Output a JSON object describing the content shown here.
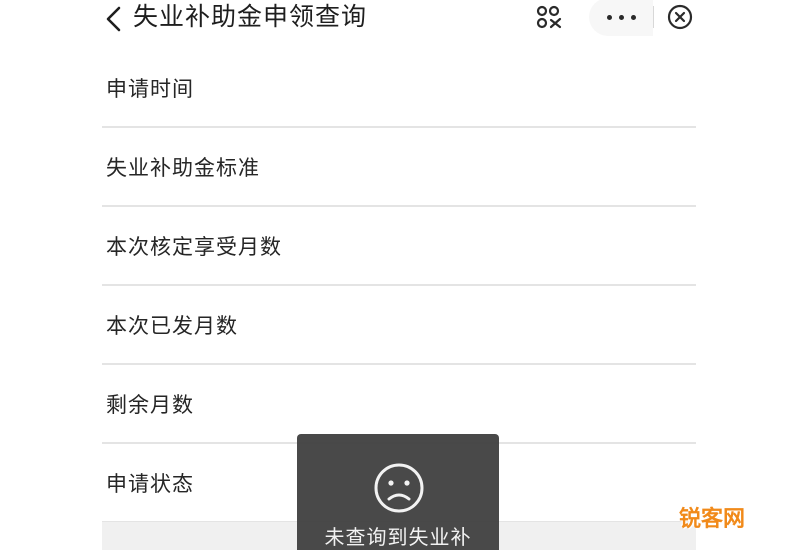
{
  "header": {
    "title": "失业补助金申领查询",
    "back_icon": "chevron-left-icon",
    "scan_icon": "scan-icon",
    "more_icon": "more-icon",
    "close_icon": "close-circle-icon"
  },
  "rows": [
    {
      "label": "申请时间"
    },
    {
      "label": "失业补助金标准"
    },
    {
      "label": "本次核定享受月数"
    },
    {
      "label": "本次已发月数"
    },
    {
      "label": "剩余月数"
    },
    {
      "label": "申请状态"
    }
  ],
  "toast": {
    "icon": "sad-face-icon",
    "message": "未查询到失业补"
  },
  "watermark": {
    "text": "锐客网",
    "color": "#f18a1a"
  }
}
